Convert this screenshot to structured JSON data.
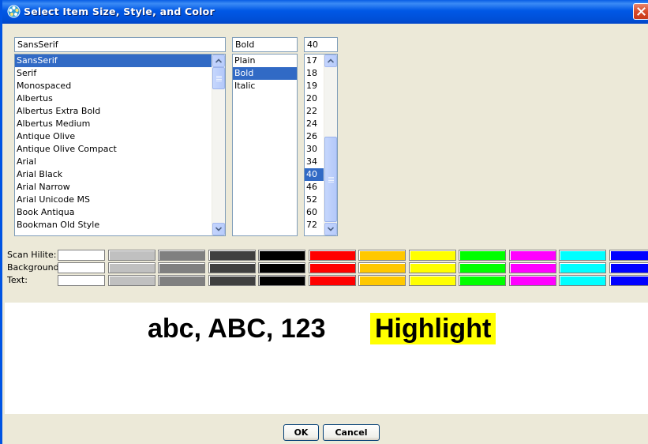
{
  "window": {
    "title": "Select Item Size, Style, and Color"
  },
  "font_family": {
    "value": "SansSerif",
    "items": [
      "SansSerif",
      "Serif",
      "Monospaced",
      "Albertus",
      "Albertus Extra Bold",
      "Albertus Medium",
      "Antique Olive",
      "Antique Olive Compact",
      "Arial",
      "Arial Black",
      "Arial Narrow",
      "Arial Unicode MS",
      "Book Antiqua",
      "Bookman Old Style"
    ],
    "selected": "SansSerif"
  },
  "font_style": {
    "value": "Bold",
    "items": [
      "Plain",
      "Bold",
      "Italic"
    ],
    "selected": "Bold"
  },
  "font_size": {
    "value": "40",
    "items": [
      "17",
      "18",
      "19",
      "20",
      "22",
      "24",
      "26",
      "30",
      "34",
      "40",
      "46",
      "52",
      "60",
      "72"
    ],
    "selected": "40"
  },
  "color_rows": {
    "scan_hilite": "Scan Hilite:",
    "background": "Background:",
    "text": "Text:"
  },
  "palette": [
    "#ffffff",
    "#c0c0c0",
    "#808080",
    "#404040",
    "#000000",
    "#ff0000",
    "#ffc800",
    "#ffff00",
    "#00ff00",
    "#ff00ff",
    "#00ffff",
    "#0000ff"
  ],
  "preview": {
    "plain_text": "abc, ABC, 123",
    "highlight_text": "Highlight",
    "highlight_color": "#ffff00"
  },
  "buttons": {
    "ok": "OK",
    "cancel": "Cancel"
  }
}
